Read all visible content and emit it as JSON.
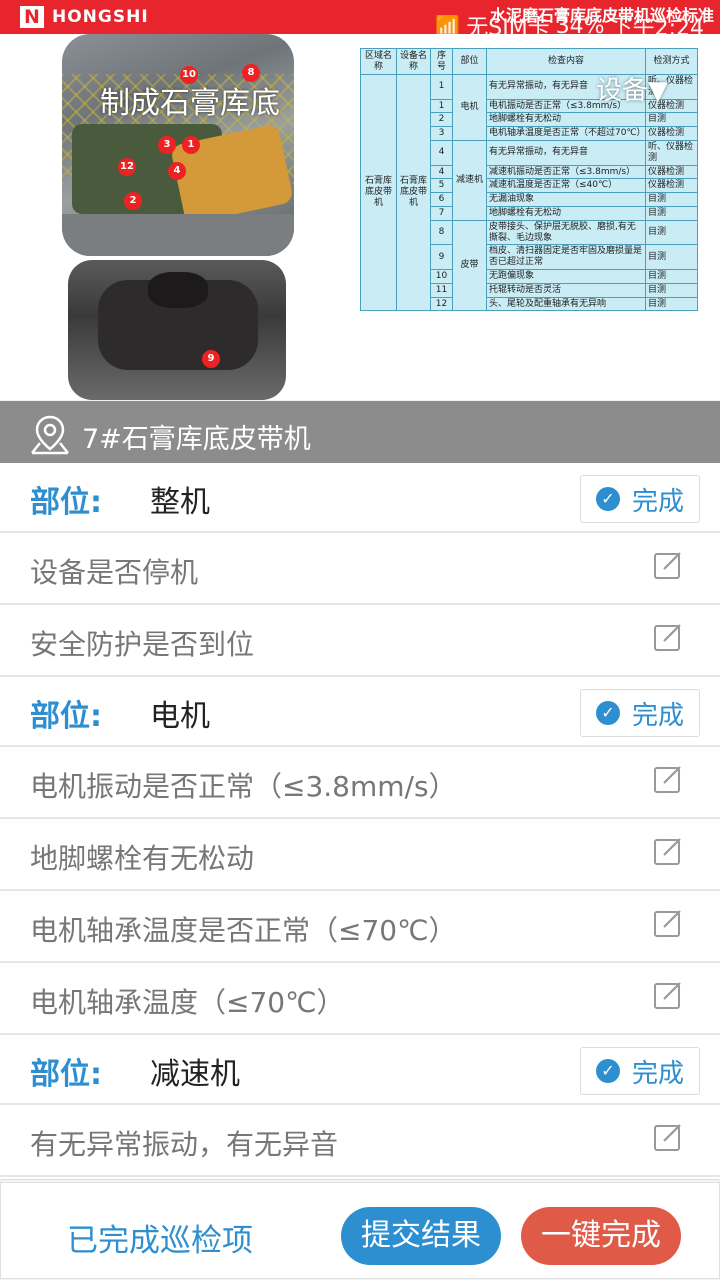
{
  "status_bar": {
    "brand": "HONGSHI",
    "logo_letter": "N",
    "title": "水泥磨石膏库底皮带机巡检标准",
    "network": "无SIM卡",
    "battery": "34%",
    "time": "下午2:24"
  },
  "header": {
    "photo_caption": "制成石膏库底",
    "device_select": "设备▼",
    "photo_markers": [
      "10",
      "8",
      "3",
      "1",
      "12",
      "4",
      "2"
    ],
    "photo2_marker": "9",
    "standard_table": {
      "headers": [
        "区域名称",
        "设备名称",
        "序号",
        "部位",
        "检查内容",
        "检测方式"
      ],
      "area": "石膏库底皮带机",
      "device": "石膏库底皮带机",
      "groups": [
        {
          "part": "电机",
          "rows": [
            {
              "no": "1",
              "content": "有无异常振动，有无异音",
              "method": "听、仪器检测"
            },
            {
              "no": "1",
              "content": "电机振动是否正常（≤3.8mm/s）",
              "method": "仪器检测"
            },
            {
              "no": "2",
              "content": "地脚螺栓有无松动",
              "method": "目测"
            },
            {
              "no": "3",
              "content": "电机轴承温度是否正常（不超过70℃）",
              "method": "仪器检测"
            }
          ]
        },
        {
          "part": "减速机",
          "rows": [
            {
              "no": "4",
              "content": "有无异常振动，有无异音",
              "method": "听、仪器检测"
            },
            {
              "no": "4",
              "content": "减速机振动是否正常（≤3.8mm/s）",
              "method": "仪器检测"
            },
            {
              "no": "5",
              "content": "减速机温度是否正常（≤40℃）",
              "method": "仪器检测"
            },
            {
              "no": "6",
              "content": "无漏油现象",
              "method": "目测"
            },
            {
              "no": "7",
              "content": "地脚螺栓有无松动",
              "method": "目测"
            }
          ]
        },
        {
          "part": "皮带",
          "rows": [
            {
              "no": "8",
              "content": "皮带接头、保护层无脱胶、磨损,有无撕裂、毛边现象",
              "method": "目测"
            },
            {
              "no": "9",
              "content": "档皮、清扫器固定是否牢固及磨损量是否已超过正常",
              "method": "目测"
            },
            {
              "no": "10",
              "content": "无跑偏现象",
              "method": "目测"
            },
            {
              "no": "11",
              "content": "托辊转动是否灵活",
              "method": "目测"
            },
            {
              "no": "12",
              "content": "头、尾轮及配重轴承有无异响",
              "method": "目测"
            }
          ]
        }
      ]
    }
  },
  "location": {
    "icon": "location-pin-icon",
    "name": "7#石膏库底皮带机"
  },
  "sections": [
    {
      "label": "部位:",
      "name": "整机",
      "done_label": "完成",
      "items": [
        "设备是否停机",
        "安全防护是否到位"
      ]
    },
    {
      "label": "部位:",
      "name": "电机",
      "done_label": "完成",
      "items": [
        "电机振动是否正常（≤3.8mm/s）",
        "地脚螺栓有无松动",
        "电机轴承温度是否正常（≤70℃）",
        "电机轴承温度（≤70℃）"
      ]
    },
    {
      "label": "部位:",
      "name": "减速机",
      "done_label": "完成",
      "items": [
        "有无异常振动，有无异音"
      ]
    }
  ],
  "bottom": {
    "completed_link": "已完成巡检项",
    "submit_label": "提交结果",
    "one_key_label": "一键完成"
  },
  "colors": {
    "status_bar": "#e8242c",
    "accent_blue": "#2d8fd0",
    "one_key_red": "#e05a48",
    "location_bar": "#8c8c8c"
  }
}
